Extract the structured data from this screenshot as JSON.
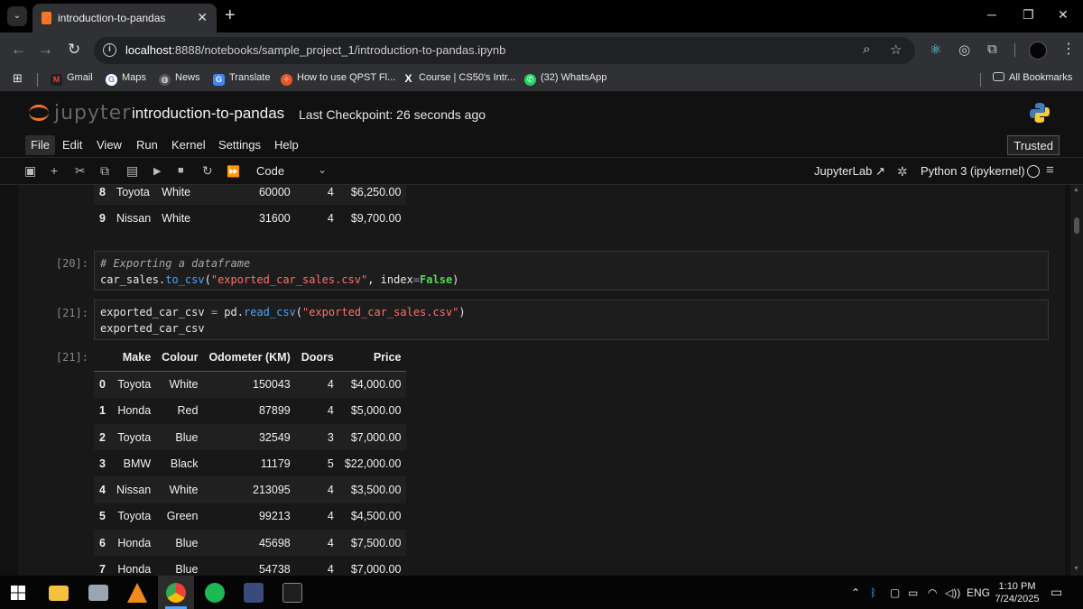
{
  "browser": {
    "tab_title": "introduction-to-pandas",
    "url_host": "localhost",
    "url_rest": ":8888/notebooks/sample_project_1/introduction-to-pandas.ipynb",
    "bookmarks": [
      "Gmail",
      "Maps",
      "News",
      "Translate",
      "How to use QPST Fl...",
      "Course | CS50's Intr...",
      "(32) WhatsApp"
    ],
    "all_bookmarks": "All Bookmarks"
  },
  "jupyter": {
    "wordmark": "jupyter",
    "notebook_name": "introduction-to-pandas",
    "checkpoint": "Last Checkpoint: 26 seconds ago",
    "menus": [
      "File",
      "Edit",
      "View",
      "Run",
      "Kernel",
      "Settings",
      "Help"
    ],
    "trusted": "Trusted",
    "cell_type": "Code",
    "jupyterlab_link": "JupyterLab",
    "kernel_name": "Python 3 (ipykernel)"
  },
  "cells": {
    "cell20_prompt": "[20]:",
    "cell20_comment": "# Exporting a dataframe",
    "cell21_prompt": "[21]:",
    "out21_prompt": "[21]:"
  },
  "prev_output_rows": [
    {
      "idx": "8",
      "make": "Toyota",
      "colour": "White",
      "odo": "60000",
      "doors": "4",
      "price": "$6,250.00"
    },
    {
      "idx": "9",
      "make": "Nissan",
      "colour": "White",
      "odo": "31600",
      "doors": "4",
      "price": "$9,700.00"
    }
  ],
  "df_headers": [
    "",
    "Make",
    "Colour",
    "Odometer (KM)",
    "Doors",
    "Price"
  ],
  "df_rows": [
    {
      "idx": "0",
      "make": "Toyota",
      "colour": "White",
      "odo": "150043",
      "doors": "4",
      "price": "$4,000.00"
    },
    {
      "idx": "1",
      "make": "Honda",
      "colour": "Red",
      "odo": "87899",
      "doors": "4",
      "price": "$5,000.00"
    },
    {
      "idx": "2",
      "make": "Toyota",
      "colour": "Blue",
      "odo": "32549",
      "doors": "3",
      "price": "$7,000.00"
    },
    {
      "idx": "3",
      "make": "BMW",
      "colour": "Black",
      "odo": "11179",
      "doors": "5",
      "price": "$22,000.00"
    },
    {
      "idx": "4",
      "make": "Nissan",
      "colour": "White",
      "odo": "213095",
      "doors": "4",
      "price": "$3,500.00"
    },
    {
      "idx": "5",
      "make": "Toyota",
      "colour": "Green",
      "odo": "99213",
      "doors": "4",
      "price": "$4,500.00"
    },
    {
      "idx": "6",
      "make": "Honda",
      "colour": "Blue",
      "odo": "45698",
      "doors": "4",
      "price": "$7,500.00"
    },
    {
      "idx": "7",
      "make": "Honda",
      "colour": "Blue",
      "odo": "54738",
      "doors": "4",
      "price": "$7,000.00"
    }
  ],
  "taskbar": {
    "lang": "ENG",
    "time": "1:10 PM",
    "date": "7/24/2025"
  },
  "colors": {
    "jupyter_orange": "#f37726",
    "string_red": "#ff6e6e",
    "function_blue": "#4aa3ff",
    "keyword_green": "#4fdb4f"
  }
}
